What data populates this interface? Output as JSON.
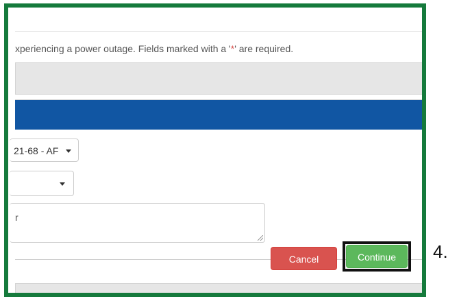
{
  "intro": {
    "text_before": "xperiencing a power outage. Fields marked with a '",
    "required_mark": "*",
    "text_after": "' are required."
  },
  "form": {
    "select_1_value": "21-68 - AF",
    "select_2_value": "",
    "textarea_value": "r"
  },
  "buttons": {
    "cancel_label": "Cancel",
    "continue_label": "Continue"
  },
  "annotation": {
    "step_label": "4."
  },
  "colors": {
    "frame_border": "#157a3c",
    "panel_header": "#1156a3",
    "cancel": "#d9534f",
    "continue": "#5cb85c",
    "highlight_outline": "#111111"
  }
}
